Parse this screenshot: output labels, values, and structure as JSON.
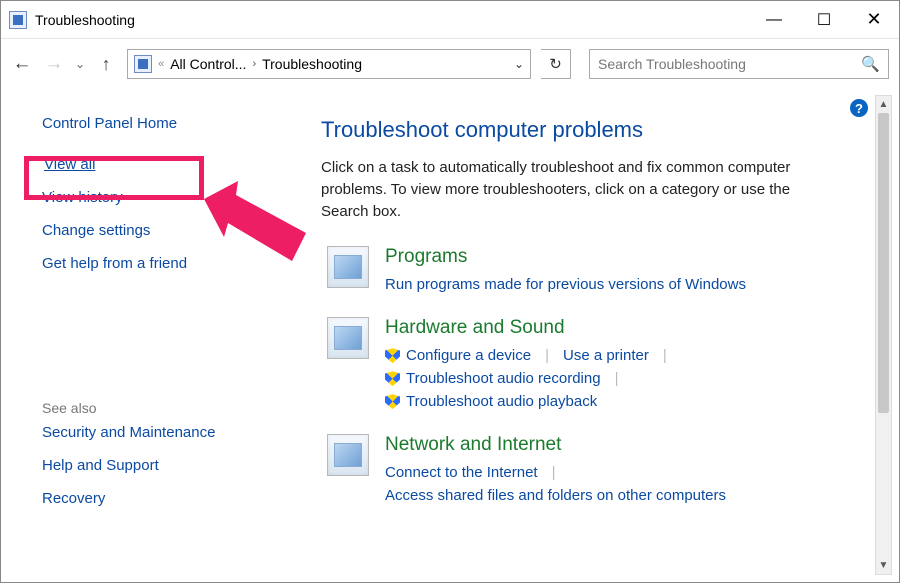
{
  "window": {
    "title": "Troubleshooting"
  },
  "nav": {
    "breadcrumb_root_hint": "«",
    "breadcrumb1": "All Control...",
    "breadcrumb2": "Troubleshooting"
  },
  "search": {
    "placeholder": "Search Troubleshooting"
  },
  "sidebar": {
    "home": "Control Panel Home",
    "view_all": "View all",
    "view_history": "View history",
    "change_settings": "Change settings",
    "get_help": "Get help from a friend",
    "see_also_heading": "See also",
    "security": "Security and Maintenance",
    "help_support": "Help and Support",
    "recovery": "Recovery"
  },
  "main": {
    "heading": "Troubleshoot computer problems",
    "intro": "Click on a task to automatically troubleshoot and fix common computer problems. To view more troubleshooters, click on a category or use the Search box.",
    "categories": [
      {
        "title": "Programs",
        "links": [
          {
            "label": "Run programs made for previous versions of Windows",
            "shield": false
          }
        ]
      },
      {
        "title": "Hardware and Sound",
        "links": [
          {
            "label": "Configure a device",
            "shield": true
          },
          {
            "label": "Use a printer",
            "shield": false
          },
          {
            "label": "Troubleshoot audio recording",
            "shield": true
          },
          {
            "label": "Troubleshoot audio playback",
            "shield": true
          }
        ]
      },
      {
        "title": "Network and Internet",
        "links": [
          {
            "label": "Connect to the Internet",
            "shield": false
          },
          {
            "label": "Access shared files and folders on other computers",
            "shield": false
          }
        ]
      }
    ]
  },
  "help_glyph": "?"
}
